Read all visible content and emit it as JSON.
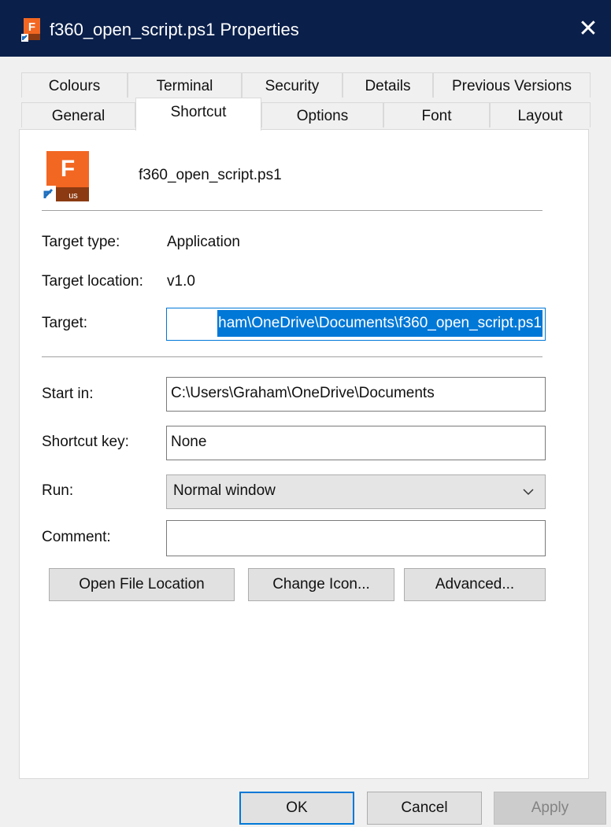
{
  "window": {
    "title": "f360_open_script.ps1 Properties",
    "close_glyph": "✕",
    "app_icon_letter": "F",
    "app_icon_badge": "FUS"
  },
  "tabs": {
    "row1": [
      {
        "label": "Colours"
      },
      {
        "label": "Terminal"
      },
      {
        "label": "Security"
      },
      {
        "label": "Details"
      },
      {
        "label": "Previous Versions"
      }
    ],
    "row2": [
      {
        "label": "General"
      },
      {
        "label": "Shortcut"
      },
      {
        "label": "Options"
      },
      {
        "label": "Font"
      },
      {
        "label": "Layout"
      }
    ],
    "active": "Shortcut"
  },
  "shortcut": {
    "file_name": "f360_open_script.ps1",
    "icon_letter": "F",
    "icon_badge": "us",
    "target_type_label": "Target type:",
    "target_type_value": "Application",
    "target_location_label": "Target location:",
    "target_location_value": "v1.0",
    "target_label": "Target:",
    "target_value": "ham\\OneDrive\\Documents\\f360_open_script.ps1",
    "start_in_label": "Start in:",
    "start_in_value": "C:\\Users\\Graham\\OneDrive\\Documents",
    "shortcut_key_label": "Shortcut key:",
    "shortcut_key_value": "None",
    "run_label": "Run:",
    "run_value": "Normal window",
    "comment_label": "Comment:",
    "comment_value": "",
    "open_file_location_label": "Open File Location",
    "change_icon_label": "Change Icon...",
    "advanced_label": "Advanced..."
  },
  "footer": {
    "ok_label": "OK",
    "cancel_label": "Cancel",
    "apply_label": "Apply"
  },
  "colors": {
    "titlebar": "#0a1f4a",
    "accent": "#0078d7",
    "icon_orange": "#f26722",
    "icon_dark": "#8b3a12"
  }
}
